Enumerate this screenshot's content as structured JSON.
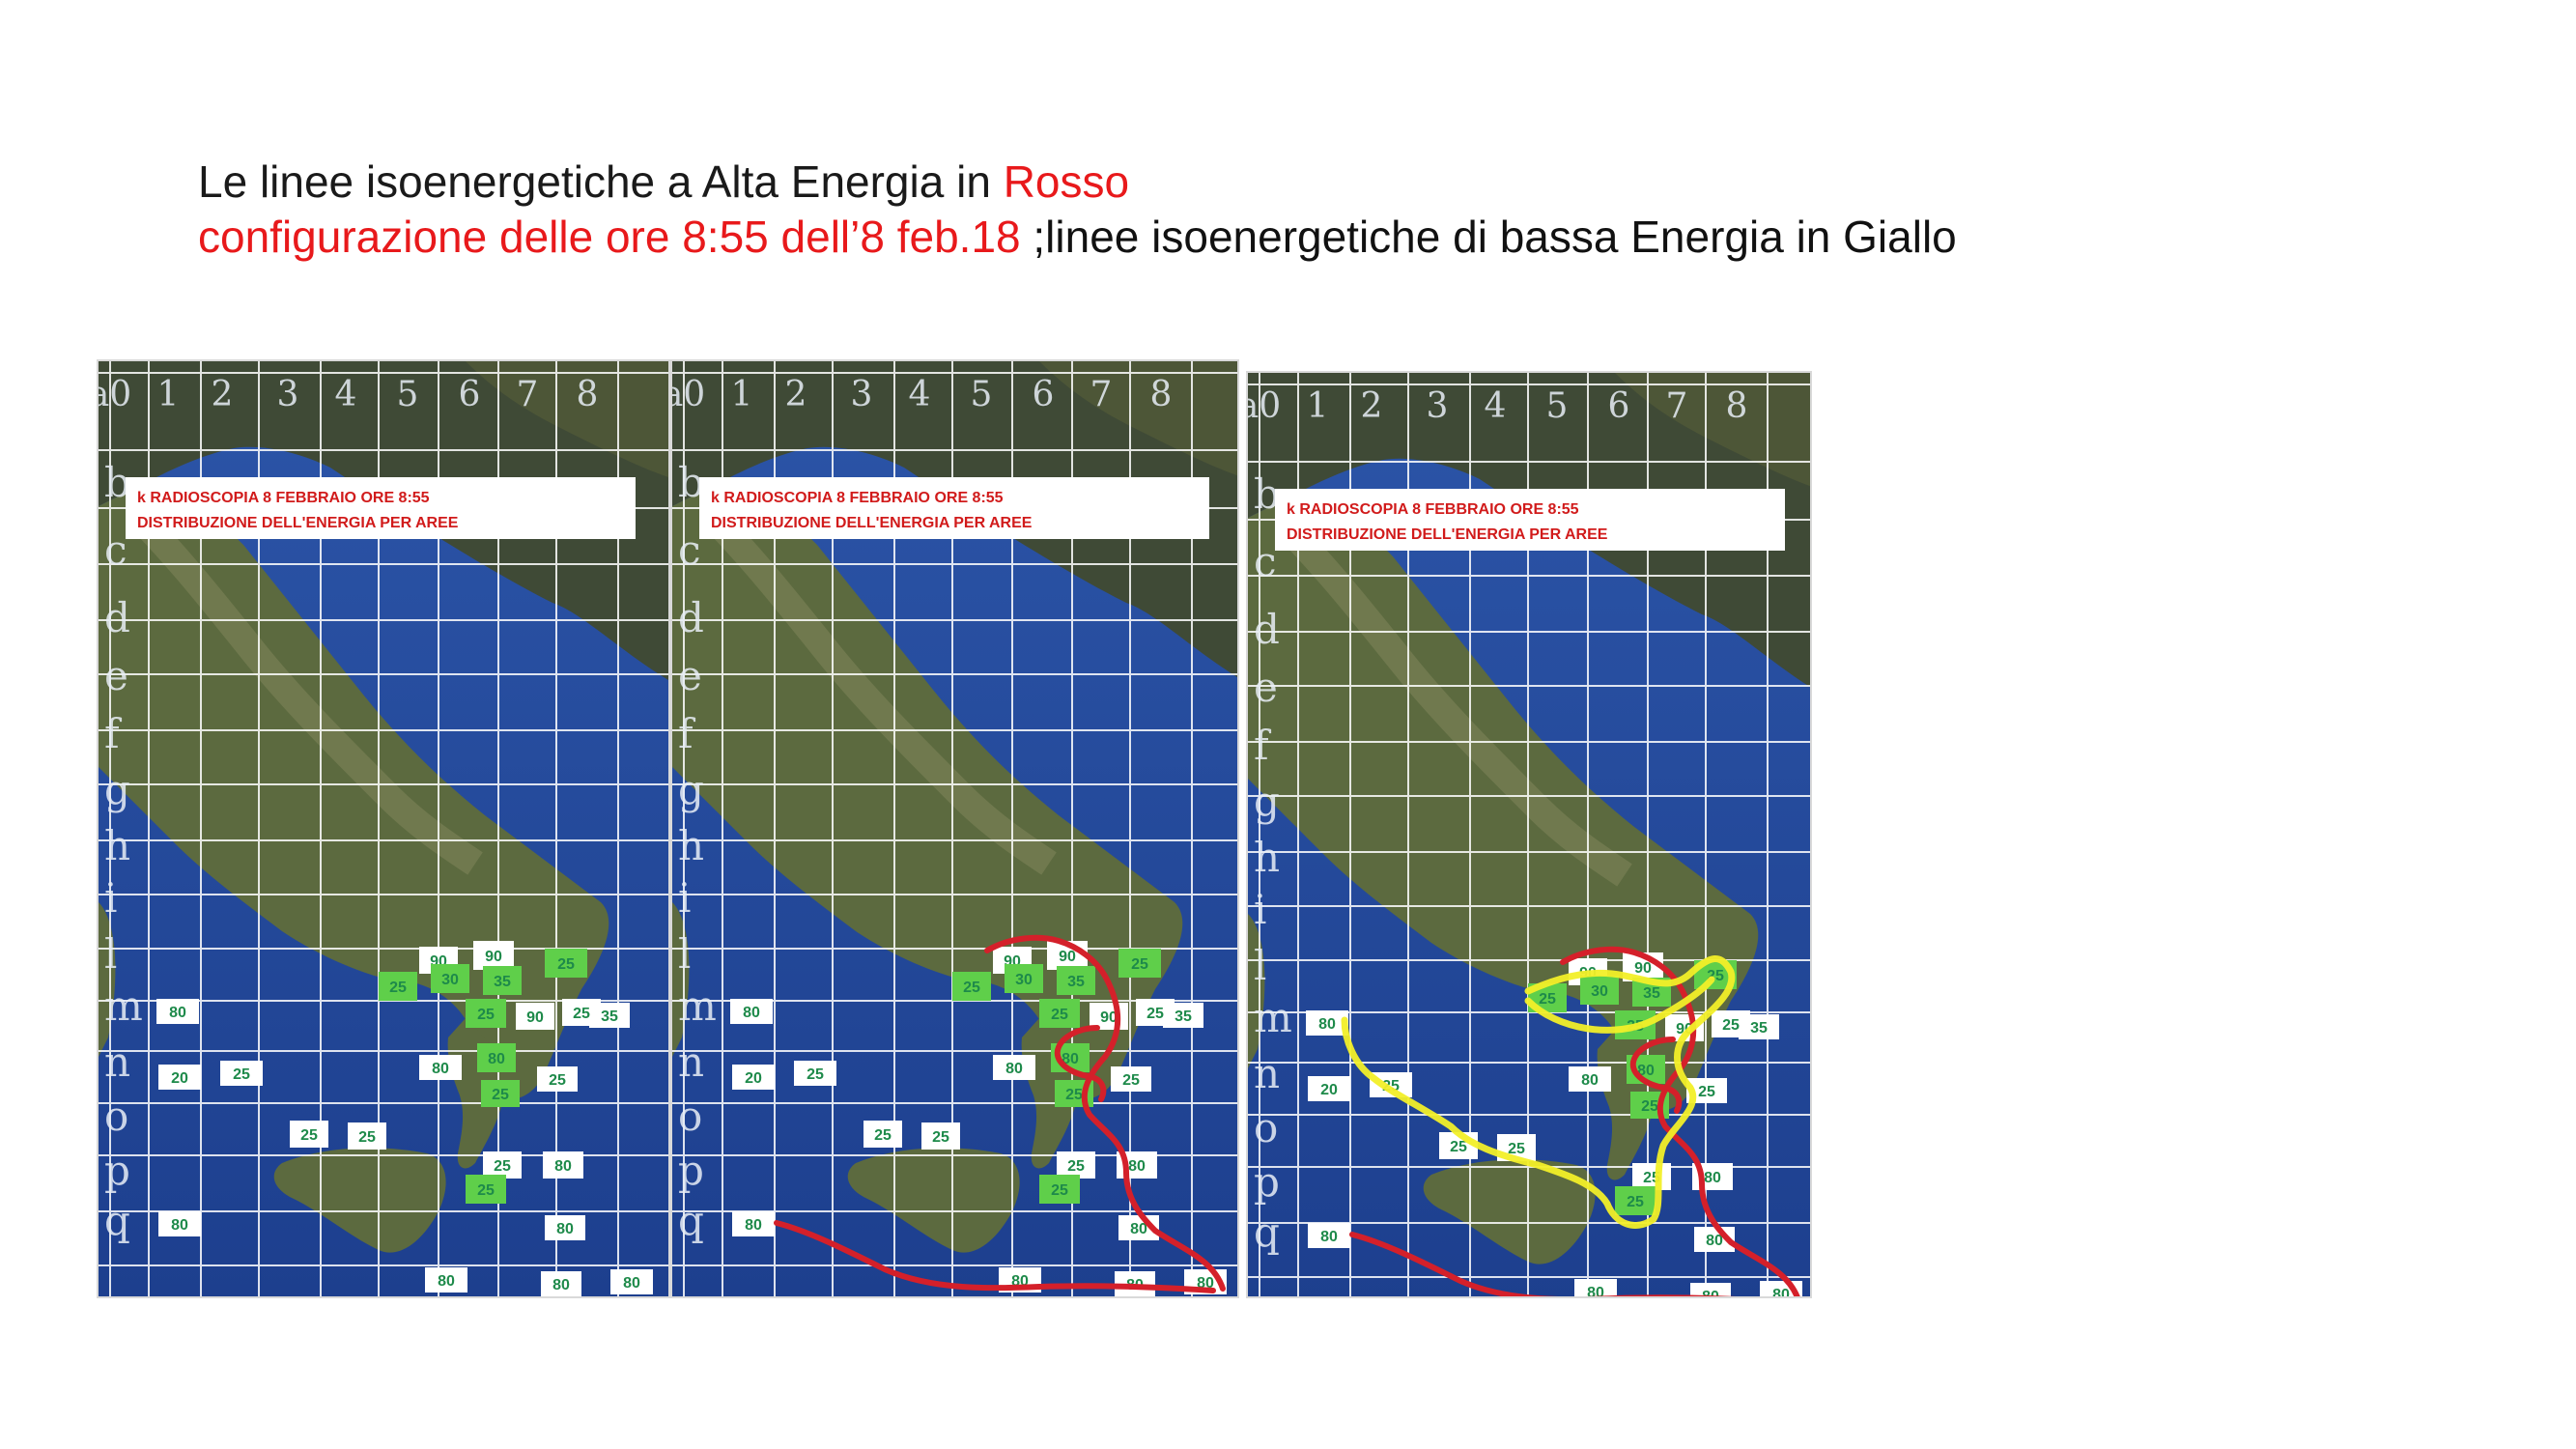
{
  "title": {
    "line1_prefix": "Le linee isoenergetiche a Alta Energia in ",
    "line1_highlight": "Rosso",
    "line2_red": "configurazione delle ore 8:55 dell’8 feb.18 ",
    "line2_black": ";linee isoenergetiche di bassa Energia in Giallo"
  },
  "colors": {
    "title_red": "#e8191b",
    "line_red": "#d4202a",
    "line_yellow": "#f2ef28",
    "label_green": "#5fcf4a",
    "label_text": "#1e8a4a",
    "caption_red": "#d11b1b"
  },
  "map": {
    "caption_line1": "k RADIOSCOPIA 8 FEBBRAIO ORE 8:55",
    "caption_line2": "DISTRIBUZIONE DELL'ENERGIA PER AREE",
    "column_labels": [
      "a0",
      "1",
      "2",
      "3",
      "4",
      "5",
      "6",
      "7",
      "8"
    ],
    "row_labels": [
      "b",
      "c",
      "d",
      "e",
      "f",
      "g",
      "h",
      "i",
      "l",
      "m",
      "n",
      "o",
      "p",
      "q"
    ],
    "labels": [
      {
        "text": "90",
        "green": false
      },
      {
        "text": "90",
        "green": false
      },
      {
        "text": "25",
        "green": true
      },
      {
        "text": "25",
        "green": true
      },
      {
        "text": "30",
        "green": true
      },
      {
        "text": "35",
        "green": true
      },
      {
        "text": "35",
        "green": false
      },
      {
        "text": "25",
        "green": true
      },
      {
        "text": "90",
        "green": false
      },
      {
        "text": "25",
        "green": false
      },
      {
        "text": "20",
        "green": false
      },
      {
        "text": "25",
        "green": false
      },
      {
        "text": "80",
        "green": false
      },
      {
        "text": "80",
        "green": true
      },
      {
        "text": "25",
        "green": false
      },
      {
        "text": "25",
        "green": true
      },
      {
        "text": "25",
        "green": false
      },
      {
        "text": "25",
        "green": false
      },
      {
        "text": "25",
        "green": false
      },
      {
        "text": "80",
        "green": false
      },
      {
        "text": "25",
        "green": true
      },
      {
        "text": "80",
        "green": false
      },
      {
        "text": "80",
        "green": false
      },
      {
        "text": "80",
        "green": false
      },
      {
        "text": "80",
        "green": false
      },
      {
        "text": "80",
        "green": false
      },
      {
        "text": "80",
        "green": false
      }
    ]
  },
  "panels": [
    {
      "id": "panel-1",
      "red_lines": false,
      "yellow_lines": false
    },
    {
      "id": "panel-2",
      "red_lines": true,
      "yellow_lines": false
    },
    {
      "id": "panel-3",
      "red_lines": true,
      "yellow_lines": true
    }
  ]
}
